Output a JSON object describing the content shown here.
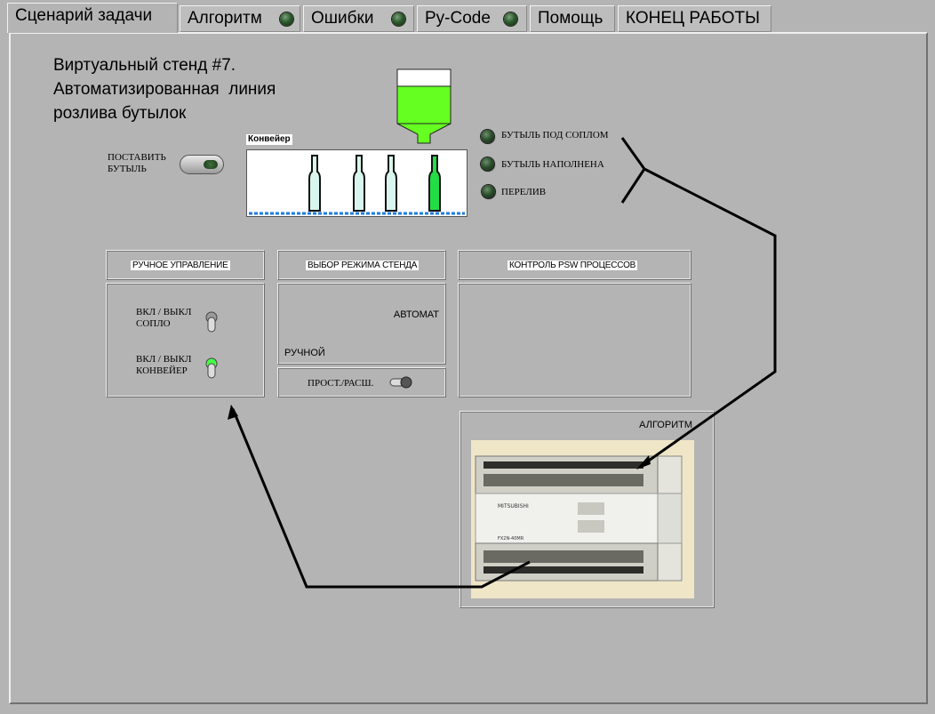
{
  "tabs": [
    {
      "label": "Сценарий задачи",
      "active": true,
      "led": false
    },
    {
      "label": "Алгоритм",
      "active": false,
      "led": true
    },
    {
      "label": "Ошибки",
      "active": false,
      "led": true
    },
    {
      "label": "Py-Code",
      "active": false,
      "led": true
    },
    {
      "label": "Помощь",
      "active": false,
      "led": false
    },
    {
      "label": "КОНЕЦ РАБОТЫ",
      "active": false,
      "led": false
    }
  ],
  "title": {
    "line1": "Виртуальный стенд #7.",
    "line2": "Автоматизированная  линия",
    "line3": "розлива бутылок"
  },
  "place_bottle": {
    "line1": "ПОСТАВИТЬ",
    "line2": "БУТЫЛЬ"
  },
  "conveyor": {
    "label": "Конвейер"
  },
  "indicators": {
    "under_nozzle": "БУТЫЛЬ ПОД СОПЛОМ",
    "filled": "БУТЫЛЬ НАПОЛНЕНА",
    "overflow": "ПЕРЕЛИВ"
  },
  "manual": {
    "header": "РУЧНОЕ УПРАВЛЕНИЕ",
    "nozzle_line1": "ВКЛ / ВЫКЛ",
    "nozzle_line2": "СОПЛО",
    "conveyor_line1": "ВКЛ / ВЫКЛ",
    "conveyor_line2": "КОНВЕЙЕР"
  },
  "mode": {
    "header": "ВЫБОР РЕЖИМА СТЕНДА",
    "auto": "АВТОМАТ",
    "manual": "РУЧНОЙ",
    "simple_ext": "ПРОСТ./РАСШ."
  },
  "psw": {
    "header": "КОНТРОЛЬ PSW ПРОЦЕССОВ"
  },
  "algorithm": {
    "label": "АЛГОРИТМ",
    "plc_brand": "MITSUBISHI",
    "plc_model": "FX2N-40MR"
  },
  "colors": {
    "background": "#b4b4b4",
    "liquid_green": "#66ff22",
    "bottle_empty": "#d8f6ee",
    "bottle_full": "#22dd44",
    "led_off": "#2c4f2c",
    "led_on": "#44ff44"
  }
}
